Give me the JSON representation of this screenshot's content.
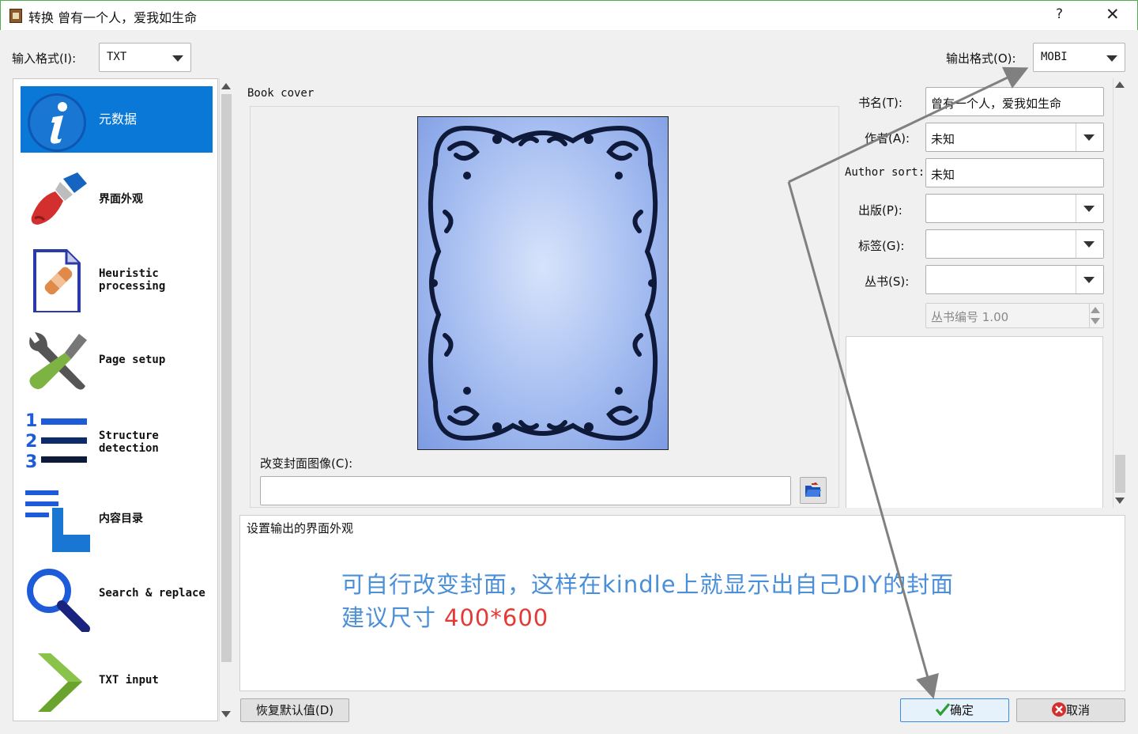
{
  "window": {
    "title": "转换 曾有一个人，爱我如生命",
    "help_label": "?",
    "close_label": "✕"
  },
  "input_format": {
    "label": "输入格式(I):",
    "value": "TXT"
  },
  "output_format": {
    "label": "输出格式(O):",
    "value": "MOBI"
  },
  "sidebar": {
    "items": [
      {
        "label": "元数据",
        "icon": "info-icon"
      },
      {
        "label": "界面外观",
        "icon": "paintbrush-icon"
      },
      {
        "label": "Heuristic processing",
        "icon": "document-bandage-icon"
      },
      {
        "label": "Page setup",
        "icon": "wrench-screwdriver-icon"
      },
      {
        "label": "Structure detection",
        "icon": "numbered-list-icon"
      },
      {
        "label": "内容目录",
        "icon": "toc-pointer-icon"
      },
      {
        "label": "Search & replace",
        "icon": "magnifier-icon"
      },
      {
        "label": "TXT input",
        "icon": "chevron-right-icon"
      }
    ]
  },
  "cover": {
    "heading": "Book cover",
    "change_label": "改变封面图像(C):",
    "path_value": ""
  },
  "metadata": {
    "title_label": "书名(T):",
    "title_value": "曾有一个人，爱我如生命",
    "author_label": "作者(A):",
    "author_value": "未知",
    "author_sort_label": "Author sort:",
    "author_sort_value": "未知",
    "publisher_label": "出版(P):",
    "publisher_value": "",
    "tags_label": "标签(G):",
    "tags_value": "",
    "series_label": "丛书(S):",
    "series_value": "",
    "series_index": "丛书编号 1.00"
  },
  "help_text": "设置输出的界面外观",
  "annotation": {
    "line1": "可自行改变封面，这样在kindle上就显示出自己DIY的封面",
    "line2": "建议尺寸",
    "size": "400*600"
  },
  "buttons": {
    "restore": "恢复默认值(D)",
    "ok": "确定",
    "cancel": "取消"
  },
  "colors": {
    "accent": "#0a78d7",
    "annotation_blue": "#4a8fd8",
    "annotation_red": "#e53935",
    "arrow": "#808080"
  }
}
